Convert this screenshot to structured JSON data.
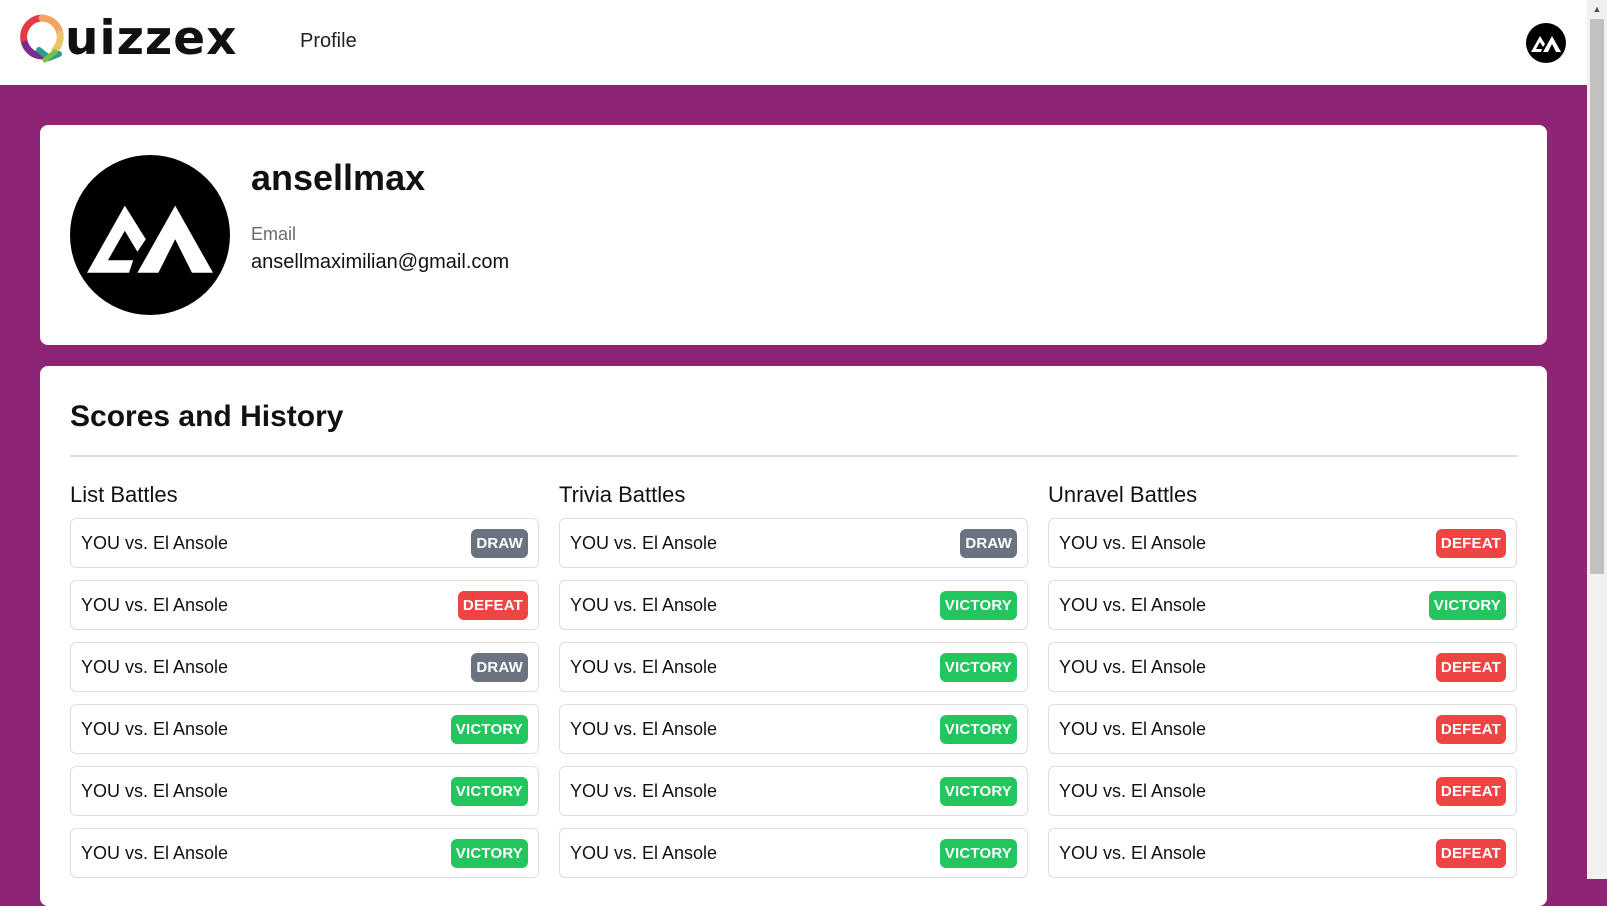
{
  "app": {
    "name": "uizzex",
    "nav_link": "Profile"
  },
  "profile": {
    "username": "ansellmax",
    "email_label": "Email",
    "email": "ansellmaximilian@gmail.com"
  },
  "history": {
    "title": "Scores and History",
    "columns": [
      {
        "title": "List Battles",
        "rows": [
          {
            "text": "YOU vs. El Ansole",
            "result": "DRAW"
          },
          {
            "text": "YOU vs. El Ansole",
            "result": "DEFEAT"
          },
          {
            "text": "YOU vs. El Ansole",
            "result": "DRAW"
          },
          {
            "text": "YOU vs. El Ansole",
            "result": "VICTORY"
          },
          {
            "text": "YOU vs. El Ansole",
            "result": "VICTORY"
          },
          {
            "text": "YOU vs. El Ansole",
            "result": "VICTORY"
          }
        ]
      },
      {
        "title": "Trivia Battles",
        "rows": [
          {
            "text": "YOU vs. El Ansole",
            "result": "DRAW"
          },
          {
            "text": "YOU vs. El Ansole",
            "result": "VICTORY"
          },
          {
            "text": "YOU vs. El Ansole",
            "result": "VICTORY"
          },
          {
            "text": "YOU vs. El Ansole",
            "result": "VICTORY"
          },
          {
            "text": "YOU vs. El Ansole",
            "result": "VICTORY"
          },
          {
            "text": "YOU vs. El Ansole",
            "result": "VICTORY"
          }
        ]
      },
      {
        "title": "Unravel Battles",
        "rows": [
          {
            "text": "YOU vs. El Ansole",
            "result": "DEFEAT"
          },
          {
            "text": "YOU vs. El Ansole",
            "result": "VICTORY"
          },
          {
            "text": "YOU vs. El Ansole",
            "result": "DEFEAT"
          },
          {
            "text": "YOU vs. El Ansole",
            "result": "DEFEAT"
          },
          {
            "text": "YOU vs. El Ansole",
            "result": "DEFEAT"
          },
          {
            "text": "YOU vs. El Ansole",
            "result": "DEFEAT"
          }
        ]
      }
    ]
  },
  "colors": {
    "page_background": "#8e2474",
    "draw": "#6b7280",
    "defeat": "#ef4444",
    "victory": "#22c55e"
  },
  "icons": {
    "logo": "quizzex-q-logo-icon",
    "avatar": "am-monogram-icon"
  }
}
